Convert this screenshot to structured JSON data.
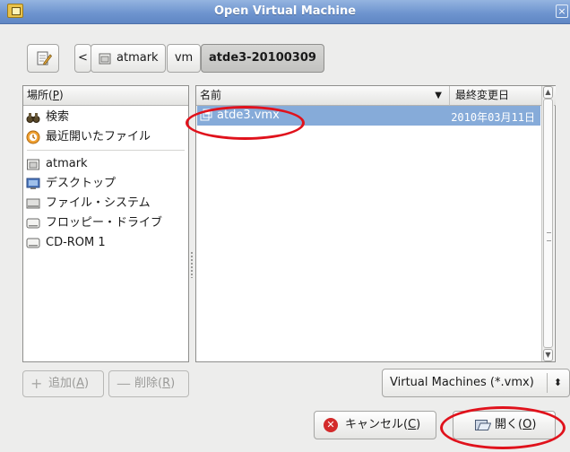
{
  "window": {
    "title": "Open Virtual Machine"
  },
  "path_bar": {
    "back_label": "<",
    "crumbs": [
      "atmark",
      "vm",
      "atde3-20100309"
    ]
  },
  "places": {
    "header": "場所(P)",
    "header_prefix": "場所(",
    "header_mnemonic": "P",
    "header_suffix": ")",
    "items": [
      {
        "label": "検索",
        "icon": "binoculars-icon"
      },
      {
        "label": "最近開いたファイル",
        "icon": "recent-icon"
      },
      {
        "label": "atmark",
        "icon": "home-folder-icon"
      },
      {
        "label": "デスクトップ",
        "icon": "desktop-icon"
      },
      {
        "label": "ファイル・システム",
        "icon": "drive-icon"
      },
      {
        "label": "フロッピー・ドライブ",
        "icon": "floppy-icon"
      },
      {
        "label": "CD-ROM 1",
        "icon": "cdrom-icon"
      }
    ],
    "add_prefix": "追加(",
    "add_mnemonic": "A",
    "add_suffix": ")",
    "remove_prefix": "削除(",
    "remove_mnemonic": "R",
    "remove_suffix": ")"
  },
  "file_list": {
    "col_name": "名前",
    "col_modified": "最終変更日",
    "files": [
      {
        "name": "atde3.vmx",
        "modified": "2010年03月11日",
        "selected": true
      }
    ]
  },
  "filter": {
    "selected": "Virtual Machines (*.vmx)"
  },
  "actions": {
    "cancel_prefix": "キャンセル(",
    "cancel_mnemonic": "C",
    "cancel_suffix": ")",
    "open_prefix": "開く(",
    "open_mnemonic": "O",
    "open_suffix": ")"
  },
  "colors": {
    "selection": "#86abd9",
    "annotation": "#e0121c",
    "titlebar": "#6f95cf"
  }
}
